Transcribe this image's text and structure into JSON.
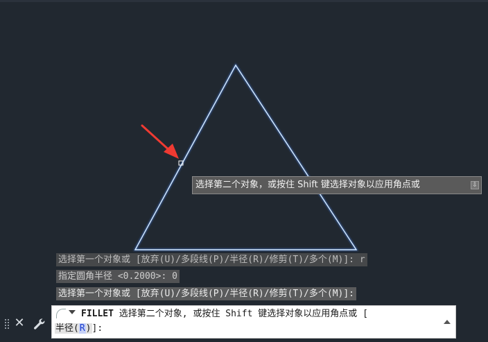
{
  "tooltip": {
    "text": "选择第二个对象，或按住 Shift 键选择对象以应用角点或",
    "icon": "expand-icon"
  },
  "history": [
    "选择第一个对象或 [放弃(U)/多段线(P)/半径(R)/修剪(T)/多个(M)]: r",
    "指定圆角半径 <0.2000>: 0",
    "选择第一个对象或 [放弃(U)/多段线(P)/半径(R)/修剪(T)/多个(M)]:"
  ],
  "command_line": {
    "command": "FILLET",
    "prompt": "选择第二个对象, 或按住 Shift 键选择对象以应用角点或 [",
    "option_label": "半径",
    "option_open": "(",
    "option_key": "R",
    "option_close": ")",
    "suffix": "]:"
  },
  "toolbar": {
    "close_symbol": "✕"
  },
  "colors": {
    "background": "#212830",
    "triangle": "#d6ecff",
    "triangle_glow": "#4f8cff",
    "arrow": "#ef3a32"
  }
}
